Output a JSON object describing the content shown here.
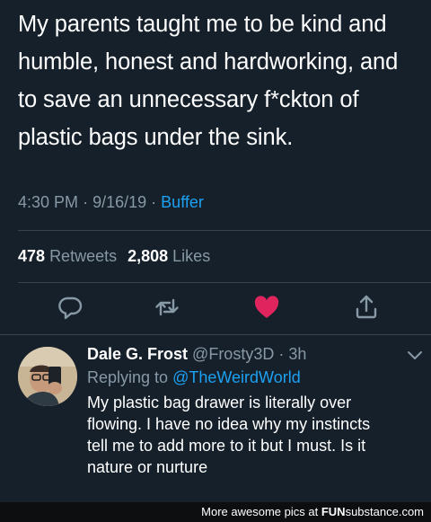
{
  "tweet": {
    "lines": [
      "My parents taught me to be kind and",
      "humble, honest and hardworking, and",
      "to save an unnecessary f*ckton of",
      "plastic bags under the sink."
    ],
    "time": "4:30 PM",
    "date": "9/16/19",
    "sep": "·",
    "source": "Buffer",
    "retweets_count": "478",
    "retweets_label": "Retweets",
    "likes_count": "2,808",
    "likes_label": "Likes"
  },
  "actions": {
    "reply_icon": "reply-icon",
    "retweet_icon": "retweet-icon",
    "like_icon": "heart-icon",
    "share_icon": "share-icon",
    "like_color": "#e0245e"
  },
  "reply": {
    "name": "Dale G. Frost",
    "handle": "@Frosty3D",
    "sep": "·",
    "time": "3h",
    "replying_prefix": "Replying to",
    "replying_handle": "@TheWeirdWorld",
    "lines": [
      "My plastic bag drawer is literally over",
      "flowing.  I have no idea why my instincts",
      "tell me to add more to it but I must.  Is it",
      "nature or nurture"
    ]
  },
  "footer": {
    "prefix": "More awesome pics at",
    "brand_a": "FUN",
    "brand_b": "substance",
    "brand_c": ".com"
  },
  "colors": {
    "background": "#15202b",
    "muted": "#8899a6",
    "link": "#1da1f2"
  }
}
